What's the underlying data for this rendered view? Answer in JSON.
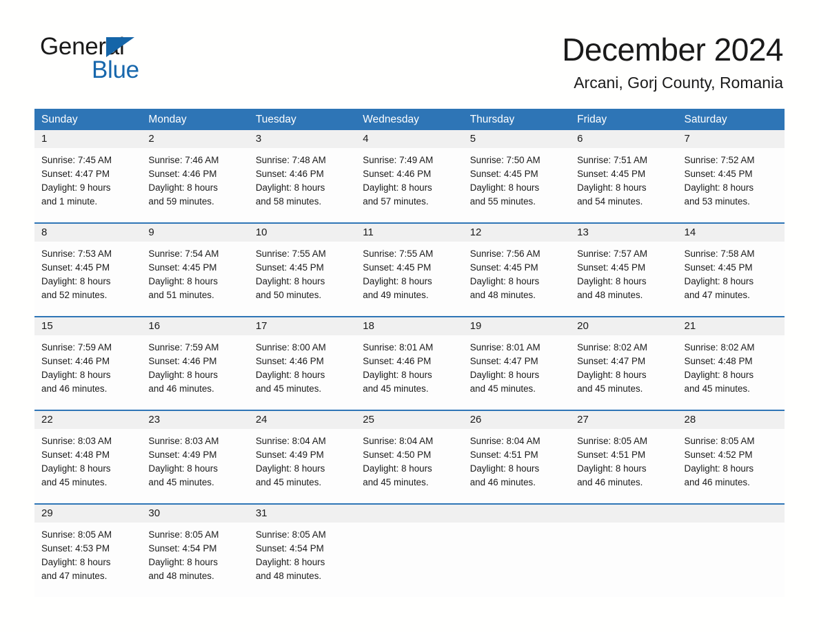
{
  "brand": {
    "word_one": "General",
    "word_two": "Blue",
    "triangle_icon": "triangle-icon",
    "accent_color": "#1767ac"
  },
  "header": {
    "month_title": "December 2024",
    "location": "Arcani, Gorj County, Romania"
  },
  "calendar": {
    "header_bg": "#2e75b6",
    "daynum_bg": "#f0f0f0",
    "weekdays": [
      "Sunday",
      "Monday",
      "Tuesday",
      "Wednesday",
      "Thursday",
      "Friday",
      "Saturday"
    ],
    "weeks": [
      [
        {
          "day": "1",
          "sunrise": "Sunrise: 7:45 AM",
          "sunset": "Sunset: 4:47 PM",
          "daylight_1": "Daylight: 9 hours",
          "daylight_2": "and 1 minute."
        },
        {
          "day": "2",
          "sunrise": "Sunrise: 7:46 AM",
          "sunset": "Sunset: 4:46 PM",
          "daylight_1": "Daylight: 8 hours",
          "daylight_2": "and 59 minutes."
        },
        {
          "day": "3",
          "sunrise": "Sunrise: 7:48 AM",
          "sunset": "Sunset: 4:46 PM",
          "daylight_1": "Daylight: 8 hours",
          "daylight_2": "and 58 minutes."
        },
        {
          "day": "4",
          "sunrise": "Sunrise: 7:49 AM",
          "sunset": "Sunset: 4:46 PM",
          "daylight_1": "Daylight: 8 hours",
          "daylight_2": "and 57 minutes."
        },
        {
          "day": "5",
          "sunrise": "Sunrise: 7:50 AM",
          "sunset": "Sunset: 4:45 PM",
          "daylight_1": "Daylight: 8 hours",
          "daylight_2": "and 55 minutes."
        },
        {
          "day": "6",
          "sunrise": "Sunrise: 7:51 AM",
          "sunset": "Sunset: 4:45 PM",
          "daylight_1": "Daylight: 8 hours",
          "daylight_2": "and 54 minutes."
        },
        {
          "day": "7",
          "sunrise": "Sunrise: 7:52 AM",
          "sunset": "Sunset: 4:45 PM",
          "daylight_1": "Daylight: 8 hours",
          "daylight_2": "and 53 minutes."
        }
      ],
      [
        {
          "day": "8",
          "sunrise": "Sunrise: 7:53 AM",
          "sunset": "Sunset: 4:45 PM",
          "daylight_1": "Daylight: 8 hours",
          "daylight_2": "and 52 minutes."
        },
        {
          "day": "9",
          "sunrise": "Sunrise: 7:54 AM",
          "sunset": "Sunset: 4:45 PM",
          "daylight_1": "Daylight: 8 hours",
          "daylight_2": "and 51 minutes."
        },
        {
          "day": "10",
          "sunrise": "Sunrise: 7:55 AM",
          "sunset": "Sunset: 4:45 PM",
          "daylight_1": "Daylight: 8 hours",
          "daylight_2": "and 50 minutes."
        },
        {
          "day": "11",
          "sunrise": "Sunrise: 7:55 AM",
          "sunset": "Sunset: 4:45 PM",
          "daylight_1": "Daylight: 8 hours",
          "daylight_2": "and 49 minutes."
        },
        {
          "day": "12",
          "sunrise": "Sunrise: 7:56 AM",
          "sunset": "Sunset: 4:45 PM",
          "daylight_1": "Daylight: 8 hours",
          "daylight_2": "and 48 minutes."
        },
        {
          "day": "13",
          "sunrise": "Sunrise: 7:57 AM",
          "sunset": "Sunset: 4:45 PM",
          "daylight_1": "Daylight: 8 hours",
          "daylight_2": "and 48 minutes."
        },
        {
          "day": "14",
          "sunrise": "Sunrise: 7:58 AM",
          "sunset": "Sunset: 4:45 PM",
          "daylight_1": "Daylight: 8 hours",
          "daylight_2": "and 47 minutes."
        }
      ],
      [
        {
          "day": "15",
          "sunrise": "Sunrise: 7:59 AM",
          "sunset": "Sunset: 4:46 PM",
          "daylight_1": "Daylight: 8 hours",
          "daylight_2": "and 46 minutes."
        },
        {
          "day": "16",
          "sunrise": "Sunrise: 7:59 AM",
          "sunset": "Sunset: 4:46 PM",
          "daylight_1": "Daylight: 8 hours",
          "daylight_2": "and 46 minutes."
        },
        {
          "day": "17",
          "sunrise": "Sunrise: 8:00 AM",
          "sunset": "Sunset: 4:46 PM",
          "daylight_1": "Daylight: 8 hours",
          "daylight_2": "and 45 minutes."
        },
        {
          "day": "18",
          "sunrise": "Sunrise: 8:01 AM",
          "sunset": "Sunset: 4:46 PM",
          "daylight_1": "Daylight: 8 hours",
          "daylight_2": "and 45 minutes."
        },
        {
          "day": "19",
          "sunrise": "Sunrise: 8:01 AM",
          "sunset": "Sunset: 4:47 PM",
          "daylight_1": "Daylight: 8 hours",
          "daylight_2": "and 45 minutes."
        },
        {
          "day": "20",
          "sunrise": "Sunrise: 8:02 AM",
          "sunset": "Sunset: 4:47 PM",
          "daylight_1": "Daylight: 8 hours",
          "daylight_2": "and 45 minutes."
        },
        {
          "day": "21",
          "sunrise": "Sunrise: 8:02 AM",
          "sunset": "Sunset: 4:48 PM",
          "daylight_1": "Daylight: 8 hours",
          "daylight_2": "and 45 minutes."
        }
      ],
      [
        {
          "day": "22",
          "sunrise": "Sunrise: 8:03 AM",
          "sunset": "Sunset: 4:48 PM",
          "daylight_1": "Daylight: 8 hours",
          "daylight_2": "and 45 minutes."
        },
        {
          "day": "23",
          "sunrise": "Sunrise: 8:03 AM",
          "sunset": "Sunset: 4:49 PM",
          "daylight_1": "Daylight: 8 hours",
          "daylight_2": "and 45 minutes."
        },
        {
          "day": "24",
          "sunrise": "Sunrise: 8:04 AM",
          "sunset": "Sunset: 4:49 PM",
          "daylight_1": "Daylight: 8 hours",
          "daylight_2": "and 45 minutes."
        },
        {
          "day": "25",
          "sunrise": "Sunrise: 8:04 AM",
          "sunset": "Sunset: 4:50 PM",
          "daylight_1": "Daylight: 8 hours",
          "daylight_2": "and 45 minutes."
        },
        {
          "day": "26",
          "sunrise": "Sunrise: 8:04 AM",
          "sunset": "Sunset: 4:51 PM",
          "daylight_1": "Daylight: 8 hours",
          "daylight_2": "and 46 minutes."
        },
        {
          "day": "27",
          "sunrise": "Sunrise: 8:05 AM",
          "sunset": "Sunset: 4:51 PM",
          "daylight_1": "Daylight: 8 hours",
          "daylight_2": "and 46 minutes."
        },
        {
          "day": "28",
          "sunrise": "Sunrise: 8:05 AM",
          "sunset": "Sunset: 4:52 PM",
          "daylight_1": "Daylight: 8 hours",
          "daylight_2": "and 46 minutes."
        }
      ],
      [
        {
          "day": "29",
          "sunrise": "Sunrise: 8:05 AM",
          "sunset": "Sunset: 4:53 PM",
          "daylight_1": "Daylight: 8 hours",
          "daylight_2": "and 47 minutes."
        },
        {
          "day": "30",
          "sunrise": "Sunrise: 8:05 AM",
          "sunset": "Sunset: 4:54 PM",
          "daylight_1": "Daylight: 8 hours",
          "daylight_2": "and 48 minutes."
        },
        {
          "day": "31",
          "sunrise": "Sunrise: 8:05 AM",
          "sunset": "Sunset: 4:54 PM",
          "daylight_1": "Daylight: 8 hours",
          "daylight_2": "and 48 minutes."
        },
        {
          "day": "",
          "sunrise": "",
          "sunset": "",
          "daylight_1": "",
          "daylight_2": ""
        },
        {
          "day": "",
          "sunrise": "",
          "sunset": "",
          "daylight_1": "",
          "daylight_2": ""
        },
        {
          "day": "",
          "sunrise": "",
          "sunset": "",
          "daylight_1": "",
          "daylight_2": ""
        },
        {
          "day": "",
          "sunrise": "",
          "sunset": "",
          "daylight_1": "",
          "daylight_2": ""
        }
      ]
    ]
  }
}
